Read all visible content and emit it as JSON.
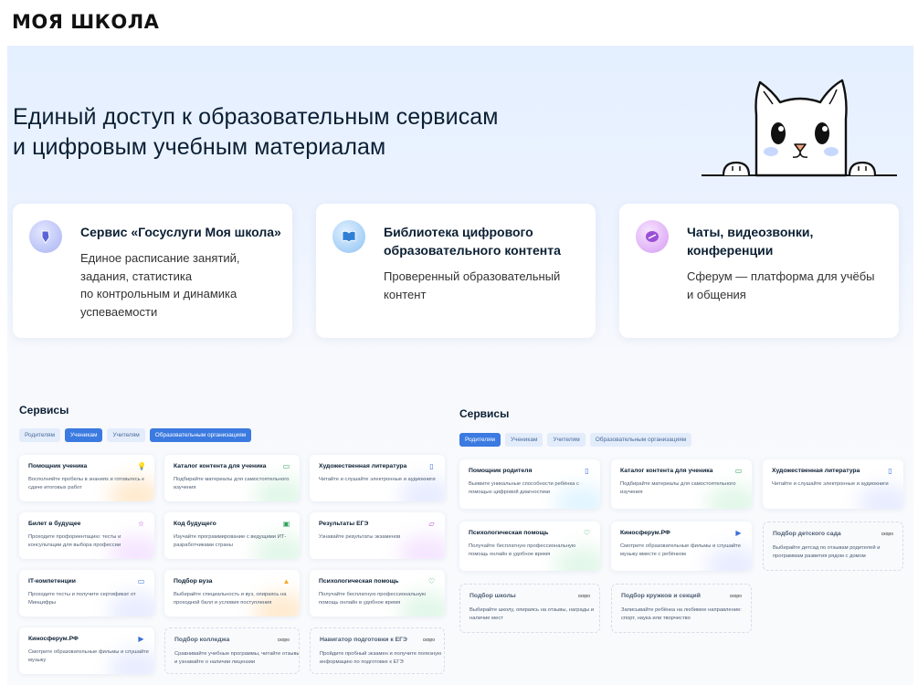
{
  "brand": {
    "logo": "МОЯ ШКОЛА"
  },
  "hero": {
    "title_line1": "Единый доступ к образовательным сервисам",
    "title_line2": "и цифровым учебным материалам"
  },
  "features": [
    {
      "title": "Сервис «Госуслуги Моя школа»",
      "desc": [
        "Единое расписание занятий,",
        "задания, статистика",
        "по контрольным и динамика",
        "успеваемости"
      ],
      "icon": "pen-icon",
      "color": "#7c86e6"
    },
    {
      "title": "Библиотека цифрового образовательного контента",
      "desc": [
        "Проверенный образовательный",
        "контент"
      ],
      "icon": "book-icon",
      "color": "#4a90e2"
    },
    {
      "title": "Чаты, видеозвонки, конференции",
      "desc": [
        "Сферум — платформа для учёбы",
        "и общения"
      ],
      "icon": "chat-icon",
      "color": "#b066e0"
    }
  ],
  "left_panel": {
    "title": "Сервисы",
    "tabs": [
      {
        "label": "Родителям",
        "active": false
      },
      {
        "label": "Ученикам",
        "active": true
      },
      {
        "label": "Учителям",
        "active": false
      },
      {
        "label": "Образовательным организациям",
        "active": true
      }
    ],
    "cards": [
      {
        "title": "Помощник ученика",
        "desc": "Восполняйте пробелы в знаниях и готовьтесь к сдаче итоговых работ",
        "icon": "lightbulb-icon",
        "glow": "#ffd9a8"
      },
      {
        "title": "Каталог контента для ученика",
        "desc": "Подбирайте материалы для самостоятельного изучения",
        "icon": "book-open-icon",
        "glow": "#c9f0d6"
      },
      {
        "title": "Художественная литература",
        "desc": "Читайте и слушайте электронные и аудиокниги",
        "icon": "tablet-icon",
        "glow": "#d4dcff"
      },
      {
        "title": "Билет в будущее",
        "desc": "Проходите профориентацию: тесты и консультации для выбора профессии",
        "icon": "star-icon",
        "glow": "#ecd0ff"
      },
      {
        "title": "Код будущего",
        "desc": "Изучайте программирование с ведущими ИТ-разработчиками страны",
        "icon": "code-icon",
        "glow": "#c9f0d6"
      },
      {
        "title": "Результаты ЕГЭ",
        "desc": "Узнавайте результаты экзаменов",
        "icon": "document-icon",
        "glow": "#ecd0ff"
      },
      {
        "title": "IT-компетенции",
        "desc": "Проходите тесты и получите сертификат от Минцифры",
        "icon": "laptop-icon",
        "glow": "#d4dcff"
      },
      {
        "title": "Подбор вуза",
        "desc": "Выбирайте специальность и вуз, опираясь на проходной балл и условия поступления",
        "icon": "graduation-cap-icon",
        "glow": "#ffd9a8"
      },
      {
        "title": "Психологическая помощь",
        "desc": "Получайте бесплатную профессиональную помощь онлайн в удобное время",
        "icon": "heart-icon",
        "glow": "#c9f0d6"
      },
      {
        "title": "Киносферум.РФ",
        "desc": "Смотрите образовательные фильмы и слушайте музыку",
        "icon": "play-icon",
        "glow": "#d4dcff"
      },
      {
        "title": "Подбор колледжа",
        "desc": "Сравнивайте учебные программы, читайте отзывы и узнавайте о наличии лицензии",
        "soon": "скоро"
      },
      {
        "title": "Навигатор подготовки к ЕГЭ",
        "desc": "Пройдите пробный экзамен и получите полезную информацию по подготовке к ЕГЭ",
        "soon": "скоро"
      }
    ]
  },
  "right_panel": {
    "title": "Сервисы",
    "tabs": [
      {
        "label": "Родителям",
        "active": true
      },
      {
        "label": "Ученикам",
        "active": false
      },
      {
        "label": "Учителям",
        "active": false
      },
      {
        "label": "Образовательным организациям",
        "active": false
      }
    ],
    "cards": [
      {
        "title": "Помощник родителя",
        "desc": "Выявите уникальные способности ребёнка с помощью цифровой диагностики",
        "icon": "tablet-icon",
        "glow": "#c9ecff"
      },
      {
        "title": "Каталог контента для ученика",
        "desc": "Подбирайте материалы для самостоятельного изучения",
        "icon": "book-open-icon",
        "glow": "#c9f0d6"
      },
      {
        "title": "Художественная литература",
        "desc": "Читайте и слушайте электронные и аудиокниги",
        "icon": "tablet-icon",
        "glow": "#d4dcff"
      },
      {
        "title": "Психологическая помощь",
        "desc": "Получайте бесплатную профессиональную помощь онлайн в удобное время",
        "icon": "heart-icon",
        "glow": "#c9f0d6"
      },
      {
        "title": "Киносферум.РФ",
        "desc": "Смотрите образовательные фильмы и слушайте музыку вместе с ребёнком",
        "icon": "play-icon",
        "glow": "#d4dcff"
      },
      {
        "title": "Подбор детского сада",
        "desc": "Выбирайте детсад по отзывам родителей и программам развития рядом с домом",
        "soon": "скоро"
      },
      {
        "title": "Подбор школы",
        "desc": "Выбирайте школу, опираясь на отзывы, награды и наличие мест",
        "soon": "скоро"
      },
      {
        "title": "Подбор кружков и секций",
        "desc": "Записывайте ребёнка на любимое направление: спорт, наука или творчество",
        "soon": "скоро"
      }
    ]
  }
}
